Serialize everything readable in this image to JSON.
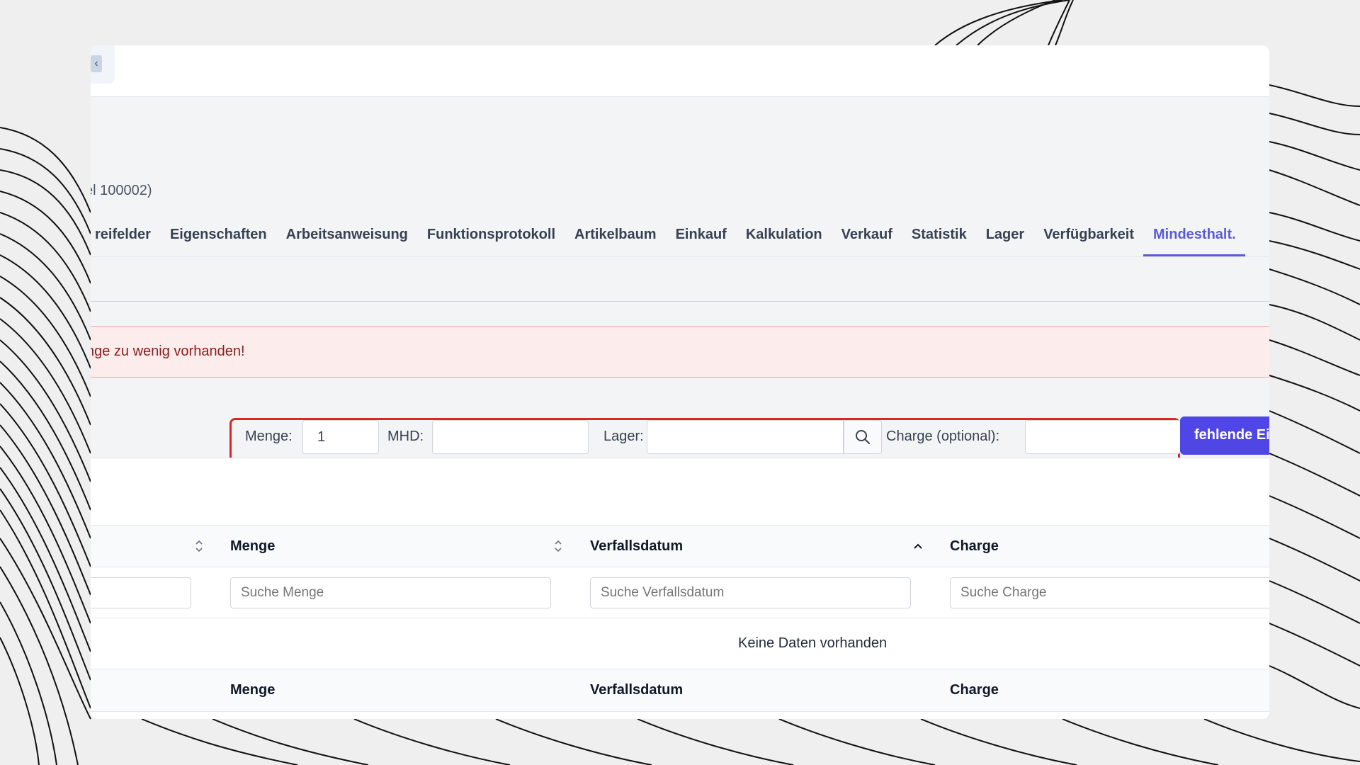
{
  "header": {
    "collapse_icon": "chevron-left-icon",
    "collapse_glyph": "‹"
  },
  "subtitle": "el 100002)",
  "tabs": [
    {
      "label": "reifelder"
    },
    {
      "label": "Eigenschaften"
    },
    {
      "label": "Arbeitsanweisung"
    },
    {
      "label": "Funktionsprotokoll"
    },
    {
      "label": "Artikelbaum"
    },
    {
      "label": "Einkauf"
    },
    {
      "label": "Kalkulation"
    },
    {
      "label": "Verkauf"
    },
    {
      "label": "Statistik"
    },
    {
      "label": "Lager"
    },
    {
      "label": "Verfügbarkeit"
    },
    {
      "label": "Mindesthalt.",
      "active": true
    }
  ],
  "alert": {
    "text": "nge zu wenig vorhanden!"
  },
  "form": {
    "menge_label": "Menge:",
    "menge_value": "1",
    "mhd_label": "MHD:",
    "mhd_value": "",
    "lager_label": "Lager:",
    "lager_value": "",
    "charge_label": "Charge (optional):",
    "charge_value": "",
    "submit_label": "fehlende Ei"
  },
  "table": {
    "columns": [
      "Menge",
      "Verfallsdatum",
      "Charge"
    ],
    "filters": {
      "menge_placeholder": "Suche Menge",
      "verfallsdatum_placeholder": "Suche Verfallsdatum",
      "charge_placeholder": "Suche Charge"
    },
    "empty_text": "Keine Daten vorhanden",
    "footer_columns": [
      "Menge",
      "Verfallsdatum",
      "Charge"
    ]
  },
  "colors": {
    "accent": "#5b5bd6",
    "primary_button": "#4f46e5",
    "alert_bg": "#fdecec",
    "alert_text": "#8b1d1d",
    "highlight_border": "#dc2626"
  }
}
